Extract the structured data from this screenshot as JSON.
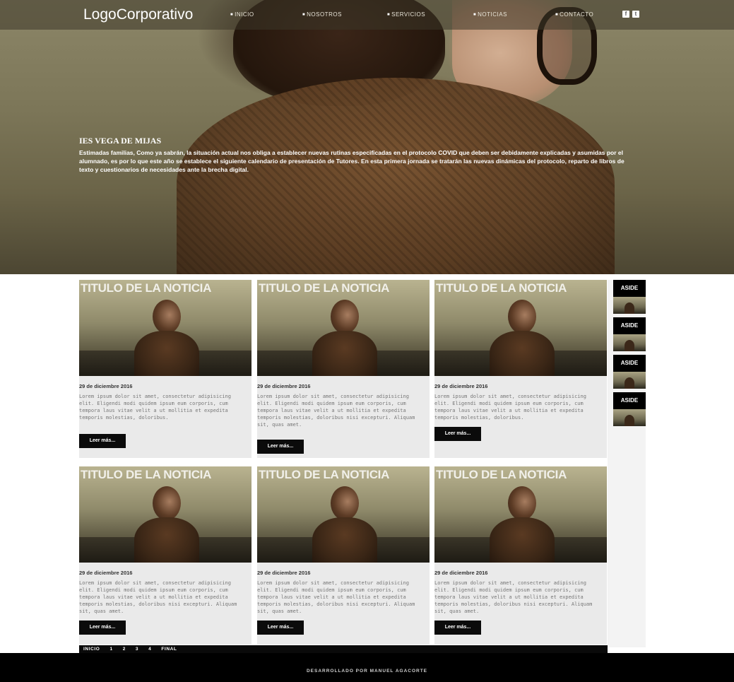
{
  "nav": {
    "logo": "LogoCorporativo",
    "items": [
      {
        "label": "INICIO"
      },
      {
        "label": "NOSOTROS"
      },
      {
        "label": "SERVICIOS"
      },
      {
        "label": "NOTICIAS"
      },
      {
        "label": "CONTACTO"
      }
    ],
    "social": [
      {
        "icon": "facebook-icon",
        "glyph": "f"
      },
      {
        "icon": "twitter-icon",
        "glyph": "t"
      }
    ]
  },
  "hero": {
    "title": "IES VEGA DE MIJAS",
    "body": "Estimadas familias, Como ya sabrán, la situación actual nos obliga a establecer nuevas rutinas especificadas en el protocolo COVID que deben ser debidamente explicadas y asumidas por el alumnado, es por lo que este año se establece el siguiente calendario de presentación de Tutores. En esta primera jornada se tratarán las nuevas dinámicas del protocolo, reparto de libros de texto y cuestionarios de necesidades ante la brecha digital."
  },
  "cards": [
    {
      "title": "TITULO DE LA NOTICIA",
      "date": "29 de diciembre 2016",
      "text": "Lorem ipsum dolor sit amet, consectetur adipisicing elit. Eligendi modi quidem ipsum eum corporis, cum tempora laus vitae velit a ut mollitia et expedita temporis molestias, doloribus.",
      "button": "Leer más..."
    },
    {
      "title": "TITULO DE LA NOTICIA",
      "date": "29 de diciembre 2016",
      "text": "Lorem ipsum dolor sit amet, consectetur adipisicing elit. Eligendi modi quidem ipsum eum corporis, cum tempora laus vitae velit a ut mollitia et expedita temporis molestias, doloribus nisi excepturi. Aliquam sit, quas amet.",
      "button": "Leer más..."
    },
    {
      "title": "TITULO DE LA NOTICIA",
      "date": "29 de diciembre 2016",
      "text": "Lorem ipsum dolor sit amet, consectetur adipisicing elit. Eligendi modi quidem ipsum eum corporis, cum tempora laus vitae velit a ut mollitia et expedita temporis molestias, doloribus.",
      "button": "Leer más..."
    },
    {
      "title": "TITULO DE LA NOTICIA",
      "date": "29 de diciembre 2016",
      "text": "Lorem ipsum dolor sit amet, consectetur adipisicing elit. Eligendi modi quidem ipsum eum corporis, cum tempora laus vitae velit a ut mollitia et expedita temporis molestias, doloribus nisi excepturi. Aliquam sit, quas amet.",
      "button": "Leer más..."
    },
    {
      "title": "TITULO DE LA NOTICIA",
      "date": "29 de diciembre 2016",
      "text": "Lorem ipsum dolor sit amet, consectetur adipisicing elit. Eligendi modi quidem ipsum eum corporis, cum tempora laus vitae velit a ut mollitia et expedita temporis molestias, doloribus nisi excepturi. Aliquam sit, quas amet.",
      "button": "Leer más..."
    },
    {
      "title": "TITULO DE LA NOTICIA",
      "date": "29 de diciembre 2016",
      "text": "Lorem ipsum dolor sit amet, consectetur adipisicing elit. Eligendi modi quidem ipsum eum corporis, cum tempora laus vitae velit a ut mollitia et expedita temporis molestias, doloribus nisi excepturi. Aliquam sit, quas amet.",
      "button": "Leer más..."
    }
  ],
  "aside": [
    {
      "label": "ASIDE"
    },
    {
      "label": "ASIDE"
    },
    {
      "label": "ASIDE"
    },
    {
      "label": "ASIDE"
    }
  ],
  "pager": [
    "INICIO",
    "1",
    "2",
    "3",
    "4",
    "FINAL"
  ],
  "footer": {
    "text": "DESARROLLADO POR MANUEL AGACORTE"
  }
}
